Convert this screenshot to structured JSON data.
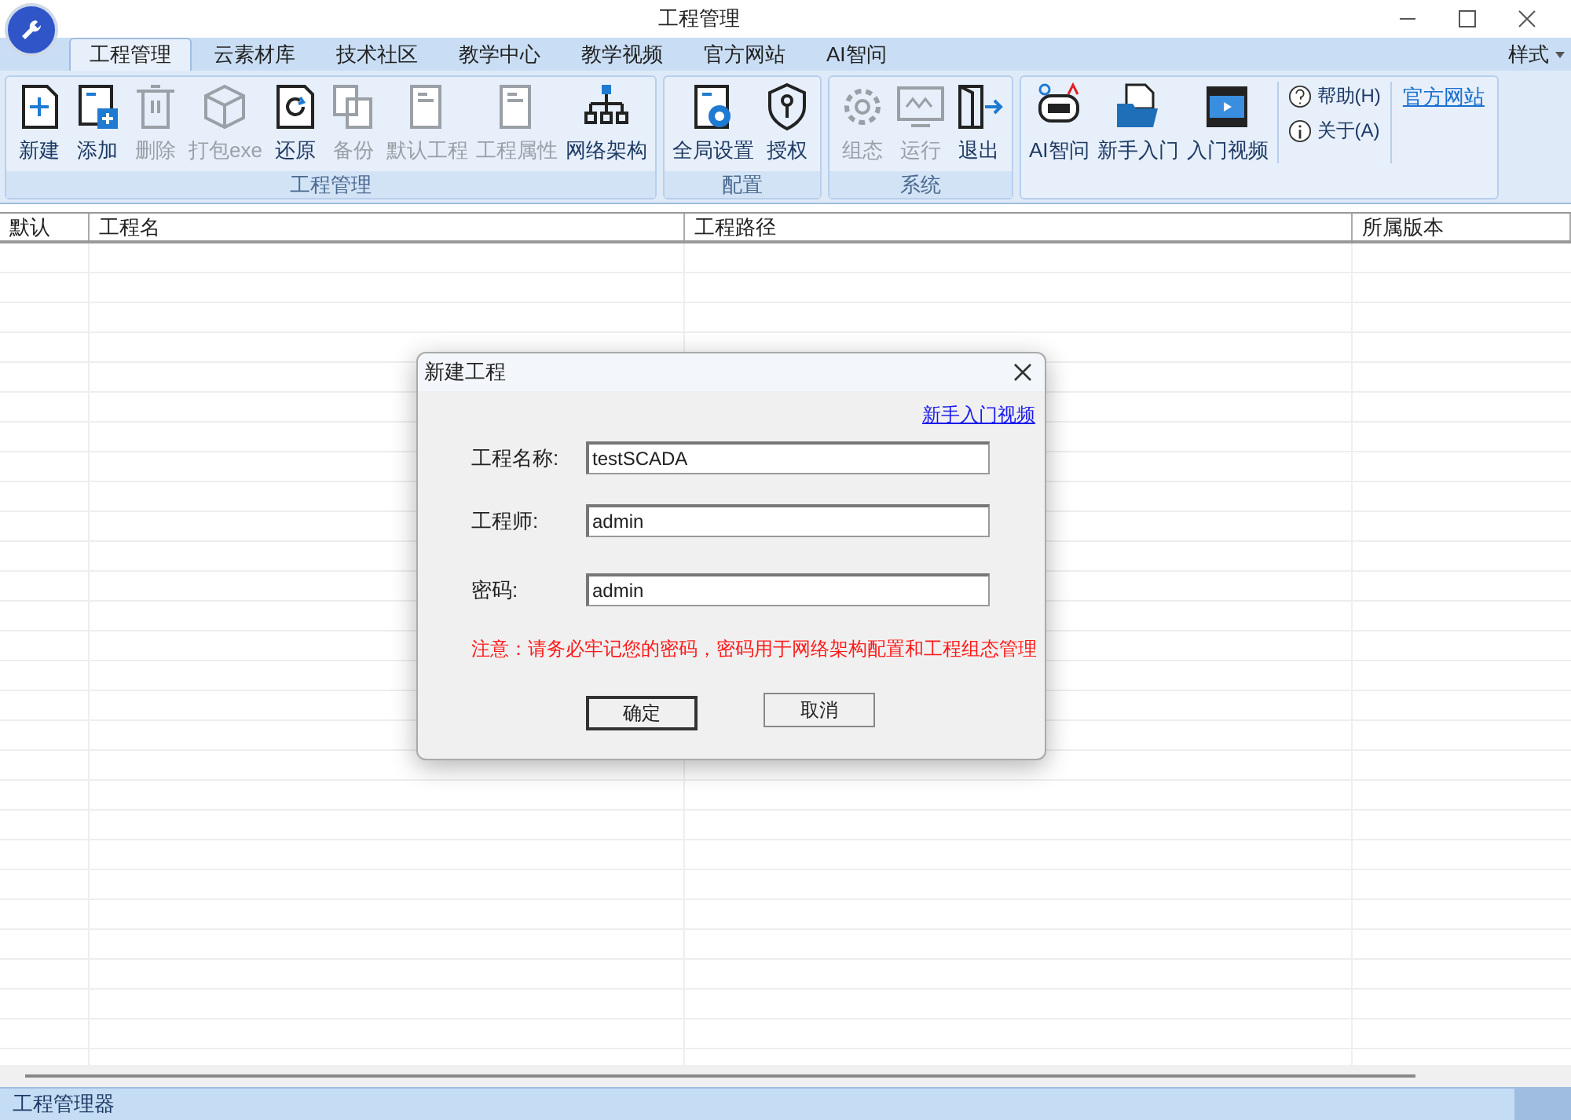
{
  "window": {
    "title": "工程管理"
  },
  "tabs": [
    {
      "label": "工程管理",
      "selected": true
    },
    {
      "label": "云素材库",
      "selected": false
    },
    {
      "label": "技术社区",
      "selected": false
    },
    {
      "label": "教学中心",
      "selected": false
    },
    {
      "label": "教学视频",
      "selected": false
    },
    {
      "label": "官方网站",
      "selected": false
    },
    {
      "label": "AI智问",
      "selected": false
    }
  ],
  "style_menu": "样式",
  "ribbon": [
    {
      "label": "工程管理",
      "items": [
        {
          "kind": "large",
          "label": "新建",
          "disabled": false
        },
        {
          "kind": "large",
          "label": "添加",
          "disabled": false
        },
        {
          "kind": "large",
          "label": "删除",
          "disabled": true
        },
        {
          "kind": "large",
          "label": "打包exe",
          "disabled": true
        },
        {
          "kind": "large",
          "label": "还原",
          "disabled": false
        },
        {
          "kind": "large",
          "label": "备份",
          "disabled": true
        },
        {
          "kind": "large",
          "label": "默认工程",
          "disabled": true
        },
        {
          "kind": "large",
          "label": "工程属性",
          "disabled": true
        },
        {
          "kind": "large",
          "label": "网络架构",
          "disabled": false
        }
      ]
    },
    {
      "label": "配置",
      "items": [
        {
          "kind": "large",
          "label": "全局设置",
          "disabled": false
        },
        {
          "kind": "large",
          "label": "授权",
          "disabled": false
        }
      ]
    },
    {
      "label": "系统",
      "items": [
        {
          "kind": "large",
          "label": "组态",
          "disabled": true
        },
        {
          "kind": "large",
          "label": "运行",
          "disabled": true
        },
        {
          "kind": "large",
          "label": "退出",
          "disabled": false
        }
      ]
    },
    {
      "items": [
        {
          "kind": "large",
          "label": "AI智问",
          "disabled": false
        },
        {
          "kind": "large",
          "label": "新手入门",
          "disabled": false
        },
        {
          "kind": "large",
          "label": "入门视频",
          "disabled": false
        },
        {
          "kind": "small",
          "labels": [
            "帮助(H)",
            "关于(A)"
          ]
        },
        {
          "kind": "link",
          "label": "官方网站"
        }
      ]
    }
  ],
  "table": {
    "columns": [
      "默认",
      "工程名",
      "工程路径",
      "所属版本"
    ]
  },
  "dialog": {
    "title": "新建工程",
    "link": "新手入门视频",
    "fields": [
      {
        "label": "工程名称:",
        "value": "testSCADA"
      },
      {
        "label": "工程师:",
        "value": "admin"
      },
      {
        "label": "密码:",
        "value": "admin"
      }
    ],
    "warning": "注意：请务必牢记您的密码，密码用于网络架构配置和工程组态管理",
    "buttons": [
      {
        "label": "确定",
        "default": true
      },
      {
        "label": "取消",
        "default": false
      }
    ]
  },
  "status_bar": "工程管理器"
}
